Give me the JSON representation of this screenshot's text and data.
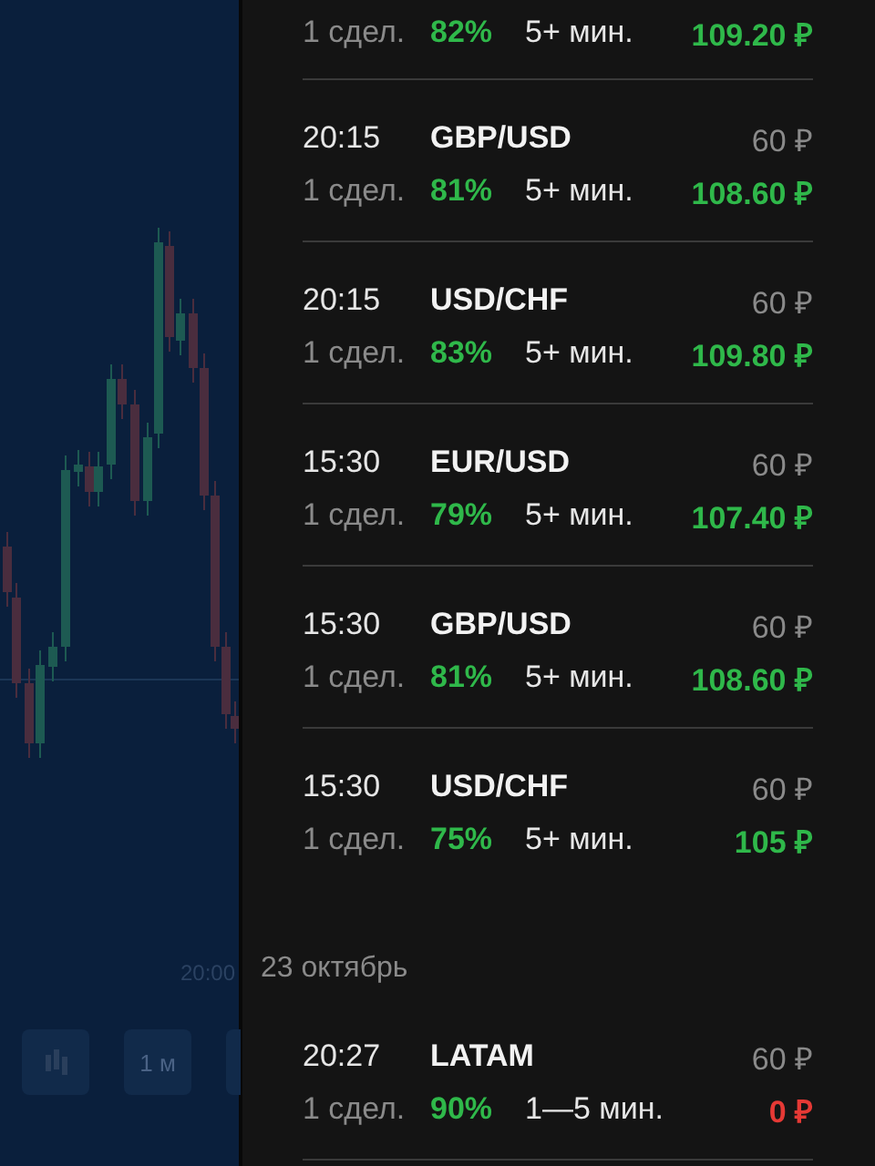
{
  "chart": {
    "time_label": "20:00",
    "toolbar": [
      {
        "kind": "candles"
      },
      {
        "kind": "text",
        "label": "1 м"
      },
      {
        "kind": "blank"
      }
    ]
  },
  "history": {
    "groups": [
      {
        "entries": [
          {
            "count": "1 сдел.",
            "percent": "82%",
            "duration": "5+ мин.",
            "payout": "109.20 ₽",
            "kind": "win"
          },
          {
            "time": "20:15",
            "pair": "GBP/USD",
            "stake": "60 ₽",
            "count": "1 сдел.",
            "percent": "81%",
            "duration": "5+ мин.",
            "payout": "108.60 ₽",
            "kind": "win"
          },
          {
            "time": "20:15",
            "pair": "USD/CHF",
            "stake": "60 ₽",
            "count": "1 сдел.",
            "percent": "83%",
            "duration": "5+ мин.",
            "payout": "109.80 ₽",
            "kind": "win"
          },
          {
            "time": "15:30",
            "pair": "EUR/USD",
            "stake": "60 ₽",
            "count": "1 сдел.",
            "percent": "79%",
            "duration": "5+ мин.",
            "payout": "107.40 ₽",
            "kind": "win"
          },
          {
            "time": "15:30",
            "pair": "GBP/USD",
            "stake": "60 ₽",
            "count": "1 сдел.",
            "percent": "81%",
            "duration": "5+ мин.",
            "payout": "108.60 ₽",
            "kind": "win"
          },
          {
            "time": "15:30",
            "pair": "USD/CHF",
            "stake": "60 ₽",
            "count": "1 сдел.",
            "percent": "75%",
            "duration": "5+ мин.",
            "payout": "105 ₽",
            "kind": "win"
          }
        ]
      },
      {
        "date": "23 октябрь",
        "entries": [
          {
            "time": "20:27",
            "pair": "LATAM",
            "stake": "60 ₽",
            "count": "1 сдел.",
            "percent": "90%",
            "duration": "1—5 мин.",
            "payout": "0 ₽",
            "kind": "loss"
          }
        ]
      }
    ]
  }
}
